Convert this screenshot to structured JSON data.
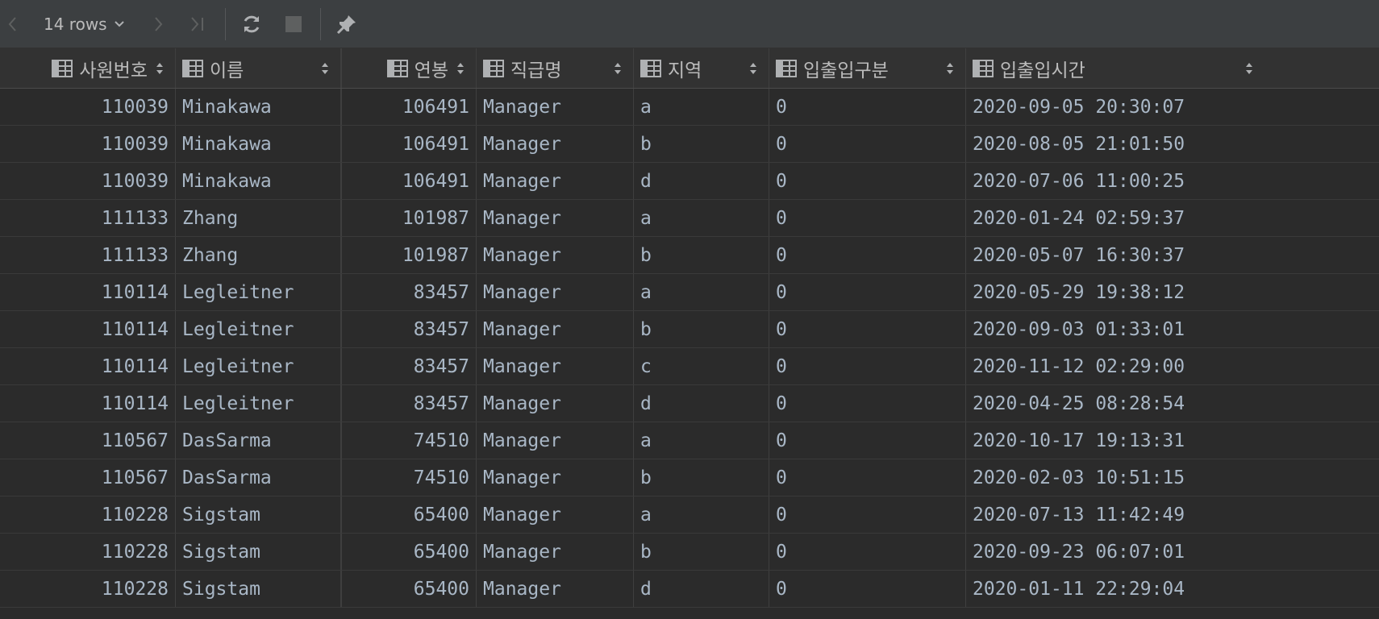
{
  "toolbar": {
    "rows_label": "14 rows",
    "icons": [
      "chevron-left-icon",
      "chevron-down-icon",
      "chevron-right-icon",
      "skip-last-icon",
      "refresh-icon",
      "stop-icon",
      "pin-icon"
    ]
  },
  "table": {
    "columns": [
      "사원번호",
      "이름",
      "연봉",
      "직급명",
      "지역",
      "입출입구분",
      "입출입시간"
    ],
    "rows": [
      [
        "110039",
        "Minakawa",
        "106491",
        "Manager",
        "a",
        "0",
        "2020-09-05 20:30:07"
      ],
      [
        "110039",
        "Minakawa",
        "106491",
        "Manager",
        "b",
        "0",
        "2020-08-05 21:01:50"
      ],
      [
        "110039",
        "Minakawa",
        "106491",
        "Manager",
        "d",
        "0",
        "2020-07-06 11:00:25"
      ],
      [
        "111133",
        "Zhang",
        "101987",
        "Manager",
        "a",
        "0",
        "2020-01-24 02:59:37"
      ],
      [
        "111133",
        "Zhang",
        "101987",
        "Manager",
        "b",
        "0",
        "2020-05-07 16:30:37"
      ],
      [
        "110114",
        "Legleitner",
        "83457",
        "Manager",
        "a",
        "0",
        "2020-05-29 19:38:12"
      ],
      [
        "110114",
        "Legleitner",
        "83457",
        "Manager",
        "b",
        "0",
        "2020-09-03 01:33:01"
      ],
      [
        "110114",
        "Legleitner",
        "83457",
        "Manager",
        "c",
        "0",
        "2020-11-12 02:29:00"
      ],
      [
        "110114",
        "Legleitner",
        "83457",
        "Manager",
        "d",
        "0",
        "2020-04-25 08:28:54"
      ],
      [
        "110567",
        "DasSarma",
        "74510",
        "Manager",
        "a",
        "0",
        "2020-10-17 19:13:31"
      ],
      [
        "110567",
        "DasSarma",
        "74510",
        "Manager",
        "b",
        "0",
        "2020-02-03 10:51:15"
      ],
      [
        "110228",
        "Sigstam",
        "65400",
        "Manager",
        "a",
        "0",
        "2020-07-13 11:42:49"
      ],
      [
        "110228",
        "Sigstam",
        "65400",
        "Manager",
        "b",
        "0",
        "2020-09-23 06:07:01"
      ],
      [
        "110228",
        "Sigstam",
        "65400",
        "Manager",
        "d",
        "0",
        "2020-01-11 22:29:04"
      ]
    ]
  },
  "colors": {
    "background": "#2b2b2b",
    "toolbar": "#3c3f41",
    "header": "#323232",
    "text": "#a9b7c6",
    "icon": "#afb1b3",
    "icon_disabled": "#5e6060"
  }
}
